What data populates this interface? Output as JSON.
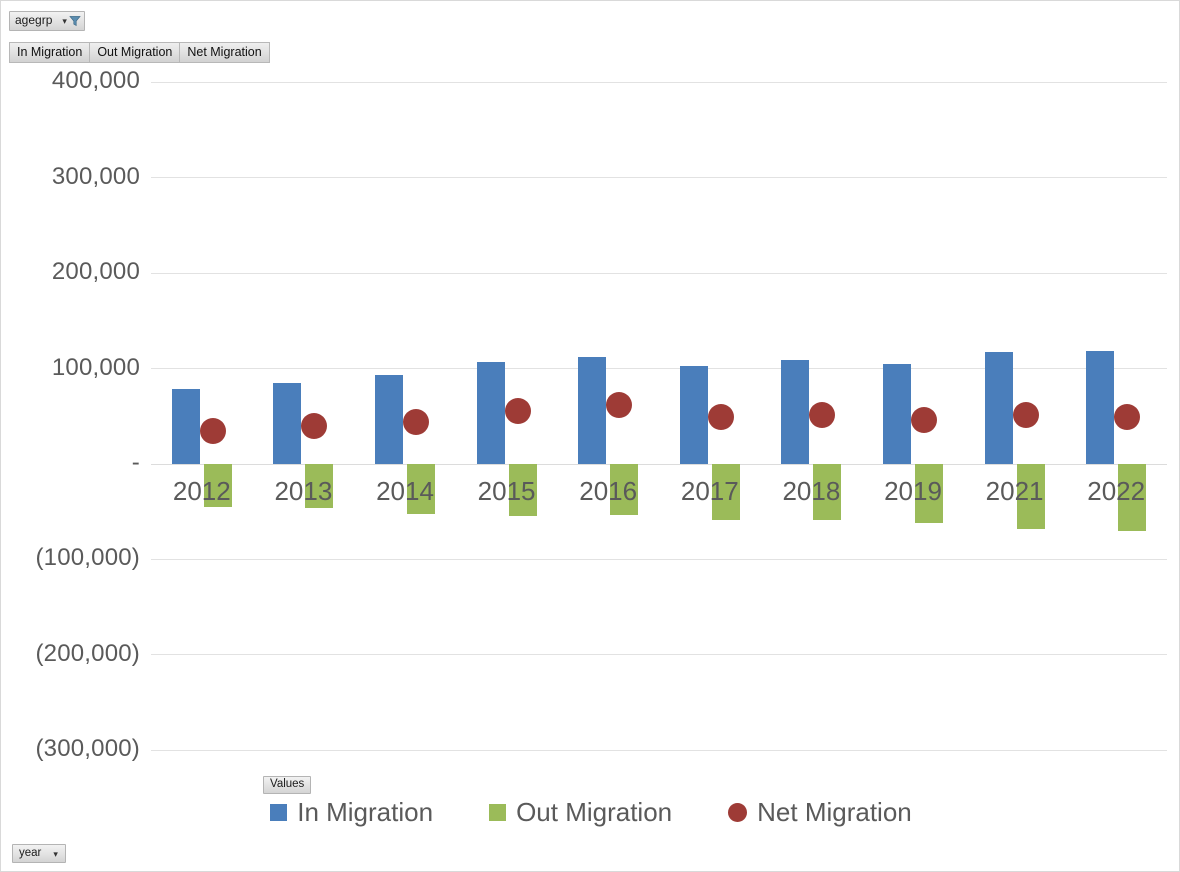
{
  "filters": {
    "agegrp": {
      "label": "agegrp",
      "caret": "▾",
      "icon": "filter-funnel-icon"
    },
    "year": {
      "label": "year",
      "caret": "▾"
    },
    "values": {
      "label": "Values"
    }
  },
  "field_buttons": [
    {
      "label": "In Migration"
    },
    {
      "label": "Out Migration"
    },
    {
      "label": "Net Migration"
    }
  ],
  "colors": {
    "in_migration": "#4a7ebb",
    "out_migration": "#9bbb59",
    "net_migration": "#9e3b36",
    "gridline": "#e2e2e2",
    "tick_text": "#5a5a5a"
  },
  "chart_data": {
    "type": "bar",
    "title": "",
    "subtitle": "",
    "xlabel": "year",
    "ylabel": "",
    "grid": true,
    "legend_position": "bottom",
    "legend_title": "Values",
    "categories": [
      "2012",
      "2013",
      "2014",
      "2015",
      "2016",
      "2017",
      "2018",
      "2019",
      "2021",
      "2022"
    ],
    "ylim": [
      -350000,
      400000
    ],
    "yticks": [
      400000,
      300000,
      200000,
      100000,
      0,
      -100000,
      -200000,
      -300000
    ],
    "ytick_labels": [
      "400,000",
      "300,000",
      "200,000",
      "100,000",
      "-",
      "(100,000)",
      "(200,000)",
      "(300,000)"
    ],
    "series": [
      {
        "name": "In Migration",
        "type": "bar",
        "color": "#4a7ebb",
        "values": [
          78600,
          84700,
          93000,
          107300,
          112600,
          102700,
          108700,
          104800,
          117000,
          118400
        ]
      },
      {
        "name": "Out Migration",
        "type": "bar",
        "color": "#9bbb59",
        "values": [
          -45000,
          -46500,
          -52000,
          -54000,
          -53500,
          -59000,
          -59000,
          -61800,
          -68100,
          -69800
        ]
      },
      {
        "name": "Net Migration",
        "type": "scatter",
        "color": "#9e3b36",
        "values": [
          34300,
          39500,
          44500,
          55300,
          61600,
          49700,
          51400,
          46100,
          51000,
          49700
        ]
      }
    ]
  }
}
